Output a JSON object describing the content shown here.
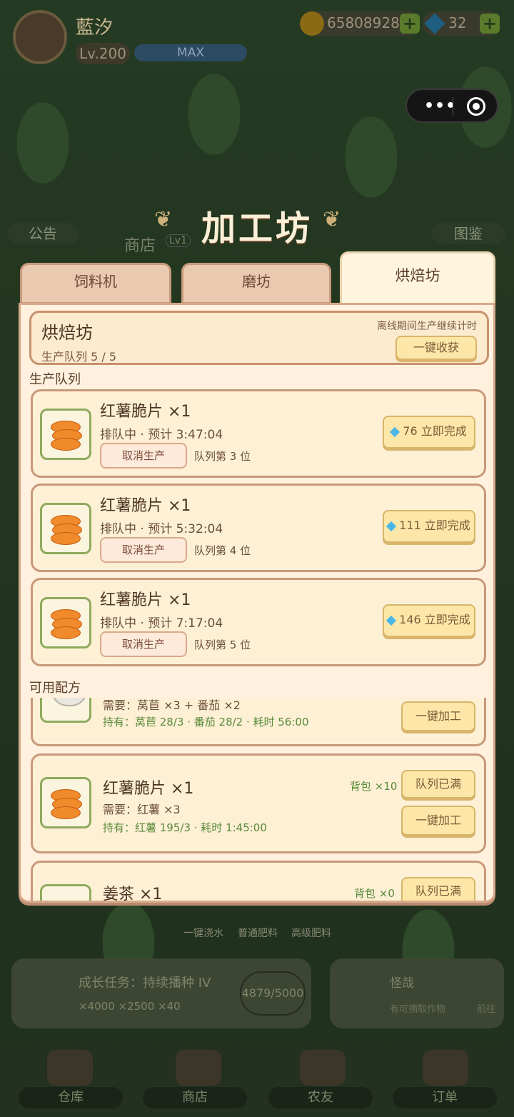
{
  "hud": {
    "name": "藍汐",
    "level": "Lv.200",
    "level_bar": "MAX",
    "coins": "65808928",
    "gems": "32"
  },
  "background": {
    "left_button": "公告",
    "right_button": "图鉴",
    "shop_label": "商店",
    "shop_level": "Lv1",
    "quick_actions": [
      "一键浇水",
      "普通肥料",
      "高级肥料"
    ],
    "task_text": "成长任务：持续播种 IV",
    "task_rewards": "×4000  ×2500  ×40",
    "task_progress": "4879/5000",
    "npc_name": "怪哉",
    "npc_hint": "有可摘取作物",
    "npc_action": "前往",
    "nav": [
      "仓库",
      "商店",
      "农友",
      "订单"
    ]
  },
  "modal": {
    "title": "加工坊",
    "tabs": [
      "饲料机",
      "磨坊",
      "烘焙坊"
    ],
    "active_tab": 2,
    "header": {
      "title": "烘焙坊",
      "queue": "生产队列 5 / 5",
      "note": "离线期间生产继续计时",
      "collect_all": "一键收获"
    },
    "queue_label": "生产队列",
    "queue": [
      {
        "name": "红薯脆片 ×1",
        "status": "排队中 · 预计 3:47:04",
        "cancel": "取消生产",
        "position": "队列第 3 位",
        "finish": "76 立即完成"
      },
      {
        "name": "红薯脆片 ×1",
        "status": "排队中 · 预计 5:32:04",
        "cancel": "取消生产",
        "position": "队列第 4 位",
        "finish": "111 立即完成"
      },
      {
        "name": "红薯脆片 ×1",
        "status": "排队中 · 预计 7:17:04",
        "cancel": "取消生产",
        "position": "队列第 5 位",
        "finish": "146 立即完成"
      }
    ],
    "recipes_label": "可用配方",
    "recipes": [
      {
        "need": "需要：莴苣 ×3 + 番茄 ×2",
        "have": "持有：莴苣 28/3 · 番茄 28/2 · 耗时 56:00",
        "btn": "一键加工"
      },
      {
        "name": "红薯脆片 ×1",
        "need": "需要：红薯 ×3",
        "have": "持有：红薯 195/3 · 耗时 1:45:00",
        "bag": "背包 ×10",
        "btn_full": "队列已满",
        "btn": "一键加工"
      },
      {
        "name": "姜茶 ×1",
        "bag": "背包 ×0",
        "btn_full": "队列已满"
      }
    ]
  },
  "colors": {
    "panel_bg": "#fff1de",
    "border": "#c9987a",
    "button": "#fde7a8",
    "green_text": "#5a8a3a"
  }
}
